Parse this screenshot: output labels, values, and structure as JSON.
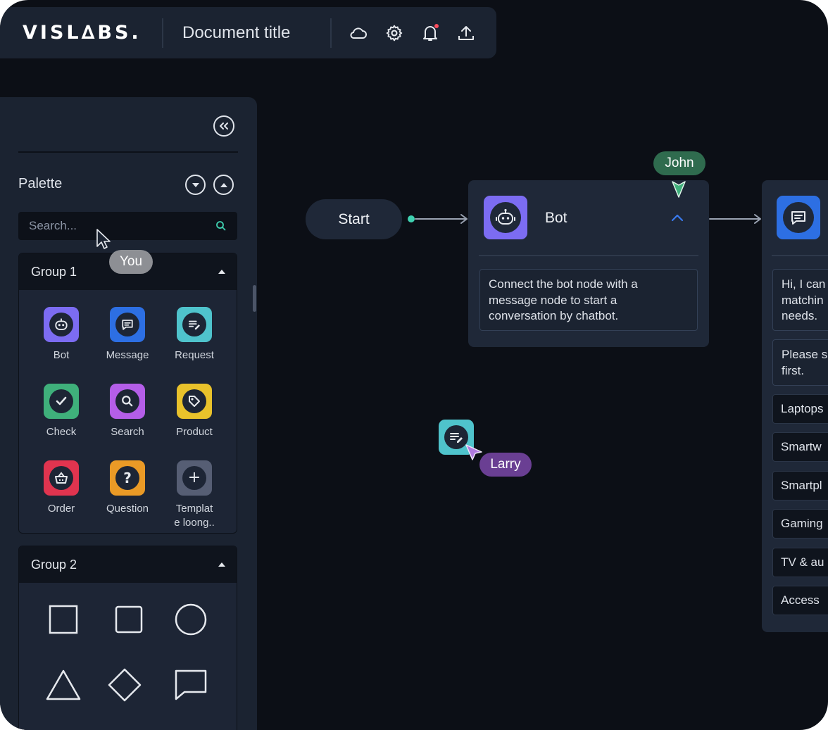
{
  "app": {
    "logo": "VISL∆BS.",
    "document_title": "Document title"
  },
  "toolbar": {
    "icons": [
      "cloud-icon",
      "gear-icon",
      "bell-icon",
      "upload-icon"
    ],
    "notification_color": "#ff4d5e"
  },
  "palette": {
    "label": "Palette",
    "search_placeholder": "Search...",
    "groups": [
      {
        "name": "Group 1",
        "items": [
          {
            "label": "Bot",
            "icon": "robot-icon",
            "color": "#7c6cf2"
          },
          {
            "label": "Message",
            "icon": "message-icon",
            "color": "#2d6fe3"
          },
          {
            "label": "Request",
            "icon": "request-icon",
            "color": "#4fc3cc"
          },
          {
            "label": "Check",
            "icon": "check-icon",
            "color": "#3fb07b"
          },
          {
            "label": "Search",
            "icon": "search-icon",
            "color": "#b45ee8"
          },
          {
            "label": "Product",
            "icon": "tag-icon",
            "color": "#e9c22b"
          },
          {
            "label": "Order",
            "icon": "basket-icon",
            "color": "#e0344f"
          },
          {
            "label": "Question",
            "icon": "question-icon",
            "color": "#ea9a26"
          },
          {
            "label": "Templat\ne loong..",
            "icon": "plus-icon",
            "color": "#565e74"
          }
        ]
      },
      {
        "name": "Group 2",
        "shapes": [
          "square",
          "rounded-square",
          "circle",
          "triangle",
          "diamond",
          "speech-bubble"
        ]
      }
    ]
  },
  "collaborators": {
    "you": {
      "label": "You",
      "color": "#8d8f94"
    },
    "john": {
      "label": "John",
      "color": "#2f6b4e"
    },
    "larry": {
      "label": "Larry",
      "color": "#6a3f93"
    }
  },
  "canvas": {
    "start_label": "Start",
    "bot_node": {
      "title": "Bot",
      "text_lines": [
        "Connect the bot node with a",
        "message node to start a",
        "conversation by chatbot."
      ]
    },
    "message_node": {
      "text1_lines": [
        "Hi, I can",
        "matchin",
        "needs."
      ],
      "text2_lines": [
        "Please s",
        "first."
      ],
      "options": [
        "Laptops",
        "Smartw",
        "Smartpl",
        "Gaming",
        "TV & au",
        "Access"
      ]
    }
  }
}
